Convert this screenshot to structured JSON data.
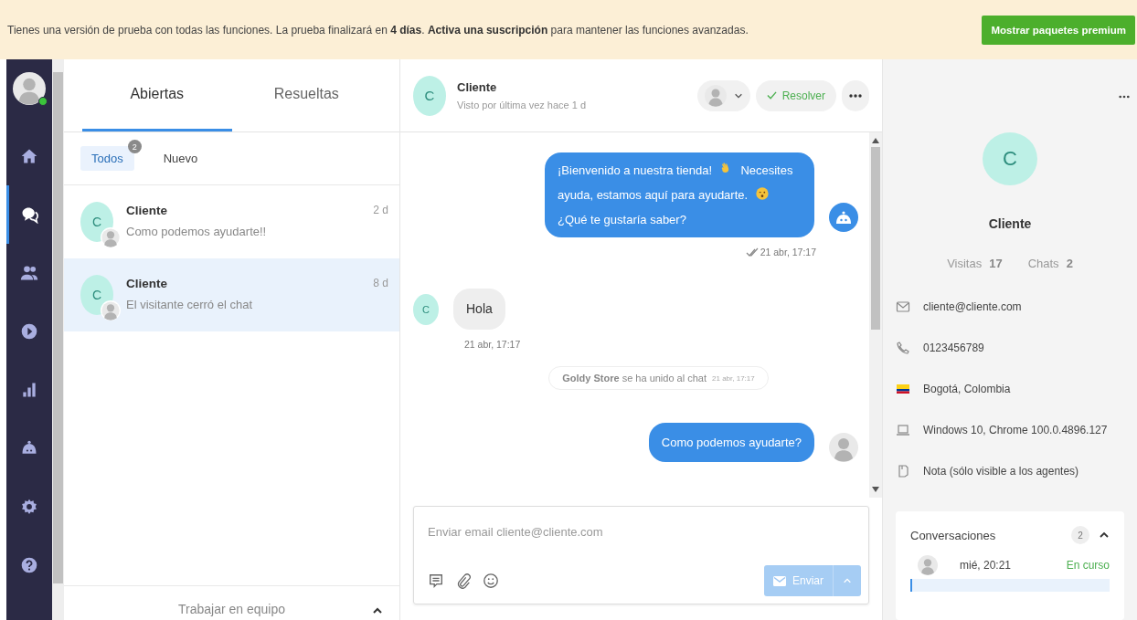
{
  "banner": {
    "text": "Tienes una versión de prueba con todas las funciones. La prueba finalizará en **4 días**. **Activa una suscripción** para mantener las funciones avanzadas.",
    "button": "Mostrar paquetes premium"
  },
  "nav": {
    "online": true,
    "items": [
      {
        "kind": "home",
        "selected": false
      },
      {
        "kind": "chat",
        "selected": true
      },
      {
        "kind": "team",
        "selected": false
      },
      {
        "kind": "play",
        "selected": false
      },
      {
        "kind": "stats",
        "selected": false
      },
      {
        "kind": "bot",
        "selected": false
      },
      {
        "kind": "settings",
        "selected": false
      },
      {
        "kind": "help",
        "selected": false
      }
    ]
  },
  "list": {
    "tabs": [
      {
        "label": "Abiertas",
        "selected": true
      },
      {
        "label": "Resueltas",
        "selected": false
      }
    ],
    "filters": [
      {
        "label": "Todos",
        "badge": "2",
        "selected": true
      },
      {
        "label": "Nuevo",
        "selected": false
      }
    ],
    "conversations": [
      {
        "initial": "C",
        "name": "Cliente",
        "preview": "Como podemos ayudarte!!",
        "time": "2 d",
        "selected": false
      },
      {
        "initial": "C",
        "name": "Cliente",
        "preview": "El visitante cerró el chat",
        "time": "8 d",
        "selected": true
      }
    ],
    "footer": "Trabajar en equipo"
  },
  "chat": {
    "initial": "C",
    "name": "Cliente",
    "subtitle": "Visto por última vez hace 1 d",
    "resolve": "Resolver",
    "messages": [
      {
        "kind": "outgoing",
        "avatar": {
          "kind": "bot"
        },
        "parts": [
          {
            "kind": "text",
            "text": "¡Bienvenido a nuestra tienda!"
          },
          {
            "kind": "wave"
          },
          {
            "kind": "text",
            "text": "Necesites ayuda, estamos aquí para ayudarte."
          },
          {
            "kind": "wink"
          },
          {
            "kind": "text",
            "text": "¿Qué te gustaría saber?"
          }
        ],
        "time": "21 abr, 17:17",
        "read": true
      },
      {
        "kind": "incoming",
        "initial": "C",
        "parts": [
          {
            "kind": "text",
            "text": "Hola"
          }
        ],
        "time": "21 abr, 17:17"
      },
      {
        "kind": "event",
        "actor": "Goldy Store",
        "text": "se ha unido al chat",
        "time": "21 abr, 17:17"
      },
      {
        "kind": "outgoing",
        "avatar": {
          "kind": "agent"
        },
        "parts": [
          {
            "kind": "text",
            "text": "Como podemos ayudarte?"
          }
        ]
      }
    ],
    "composer": {
      "placeholder": "Enviar email cliente@cliente.com",
      "send": "Enviar",
      "disabled": true
    }
  },
  "profile": {
    "initial": "C",
    "name": "Cliente",
    "stats": [
      {
        "label": "Visitas",
        "value": "17"
      },
      {
        "label": "Chats",
        "value": "2"
      }
    ],
    "details": [
      {
        "kind": "email",
        "text": "cliente@cliente.com"
      },
      {
        "kind": "phone",
        "text": "0123456789"
      },
      {
        "kind": "flag",
        "text": "Bogotá, Colombia"
      },
      {
        "kind": "device",
        "text": "Windows 10, Chrome 100.0.4896.127"
      },
      {
        "kind": "note",
        "text": "Nota (sólo visible a los agentes)"
      }
    ],
    "conversations": {
      "title": "Conversaciones",
      "count": "2",
      "expanded": true,
      "items": [
        {
          "time": "mié, 20:21",
          "status": "En curso"
        }
      ]
    }
  }
}
